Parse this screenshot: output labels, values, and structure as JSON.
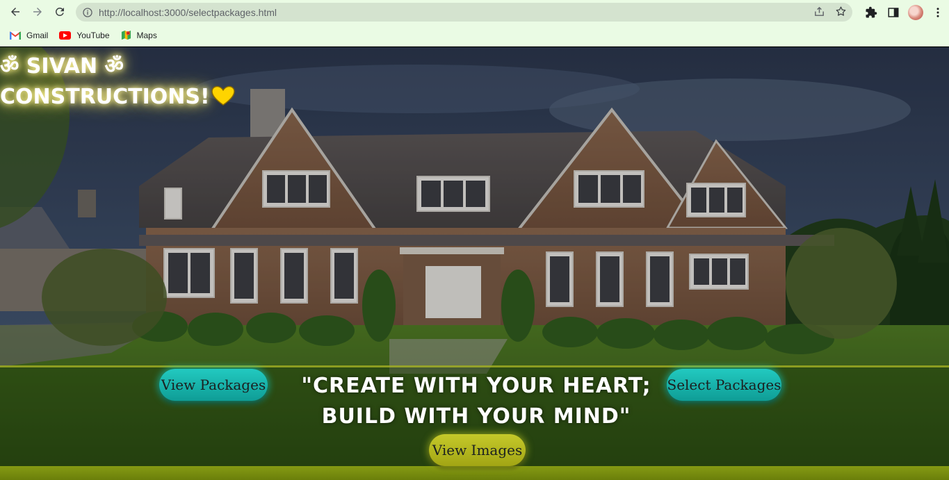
{
  "browser": {
    "url_host": "http://localhost",
    "url_path": ":3000/selectpackages.html",
    "bookmarks": [
      {
        "label": "Gmail"
      },
      {
        "label": "YouTube"
      },
      {
        "label": "Maps"
      }
    ]
  },
  "page": {
    "brand_line1": "ॐ SIVAN ॐ",
    "brand_line2": "CONSTRUCTIONS!",
    "quote_line1": "\"CREATE WITH YOUR HEART;",
    "quote_line2": "BUILD WITH YOUR MIND\"",
    "buttons": {
      "view_packages": "View Packages",
      "select_packages": "Select Packages",
      "view_images": "View Images"
    }
  },
  "colors": {
    "chrome_bg": "#eafbe4",
    "omnibox_bg": "#d4e3cf",
    "teal_button": "#14b3ab",
    "olive_button": "#b4b71e",
    "heart": "#ffd400"
  },
  "icons": {
    "back": "back-arrow-icon",
    "forward": "forward-arrow-icon",
    "reload": "reload-icon",
    "info": "info-icon",
    "share": "share-icon",
    "bookmark_star": "star-icon",
    "extensions": "puzzle-icon",
    "side_panel": "side-panel-icon",
    "menu": "kebab-menu-icon",
    "heart": "heart-icon"
  }
}
